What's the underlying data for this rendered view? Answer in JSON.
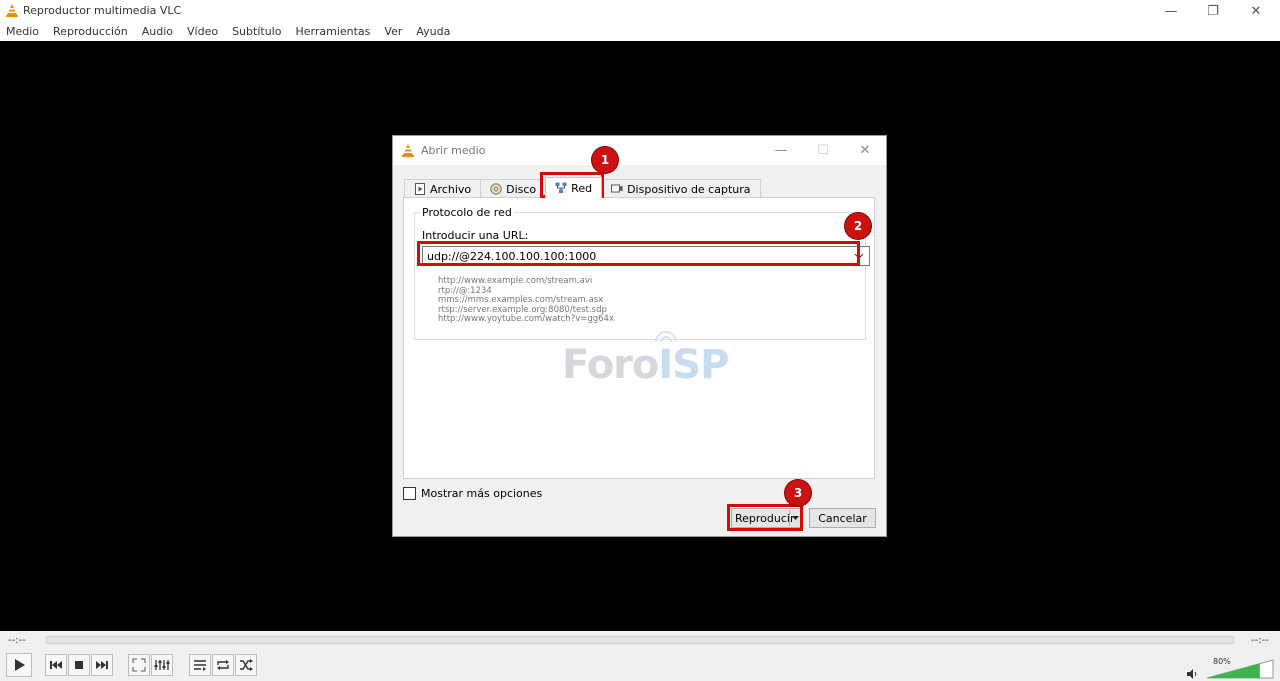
{
  "window": {
    "title": "Reproductor multimedia VLC",
    "minimize_glyph": "—",
    "restore_glyph": "❐",
    "close_glyph": "✕",
    "icon": "vlc-cone-icon"
  },
  "menubar": {
    "items": [
      "Medio",
      "Reproducción",
      "Audio",
      "Vídeo",
      "Subtítulo",
      "Herramientas",
      "Ver",
      "Ayuda"
    ]
  },
  "dialog": {
    "title": "Abrir medio",
    "icon": "vlc-cone-icon",
    "minimize_glyph": "—",
    "maximize_glyph": "☐",
    "close_glyph": "✕",
    "tabs": [
      {
        "label": "Archivo",
        "icon": "file-play-icon"
      },
      {
        "label": "Disco",
        "icon": "disc-icon"
      },
      {
        "label": "Red",
        "icon": "network-icon",
        "active": true
      },
      {
        "label": "Dispositivo de captura",
        "icon": "capture-device-icon"
      }
    ],
    "group_title": "Protocolo de red",
    "url_label": "Introducir una URL:",
    "url_value": "udp://@224.100.100.100:1000",
    "examples": [
      "http://www.example.com/stream.avi",
      "rtp://@:1234",
      "mms://mms.examples.com/stream.asx",
      "rtsp://server.example.org:8080/test.sdp",
      "http://www.yoytube.com/watch?v=gg64x"
    ],
    "watermark": {
      "part1": "Foro",
      "part2": "ISP"
    },
    "more_options_label": "Mostrar más opciones",
    "more_options_checked": false,
    "play_button_label": "Reproducir",
    "cancel_button_label": "Cancelar"
  },
  "callouts": [
    "1",
    "2",
    "3"
  ],
  "controls": {
    "elapsed": "--:--",
    "remaining": "--:--",
    "volume_percent": "80%",
    "volume_level": 0.8,
    "buttons": [
      "play-icon",
      "previous-icon",
      "stop-icon",
      "next-icon",
      "fullscreen-icon",
      "extended-settings-icon",
      "playlist-icon",
      "loop-icon",
      "shuffle-icon"
    ]
  },
  "colors": {
    "video_bg": "#000000",
    "highlight": "#d20a0a",
    "badge": "#cc1111",
    "volume_green": "#3cb54a"
  }
}
